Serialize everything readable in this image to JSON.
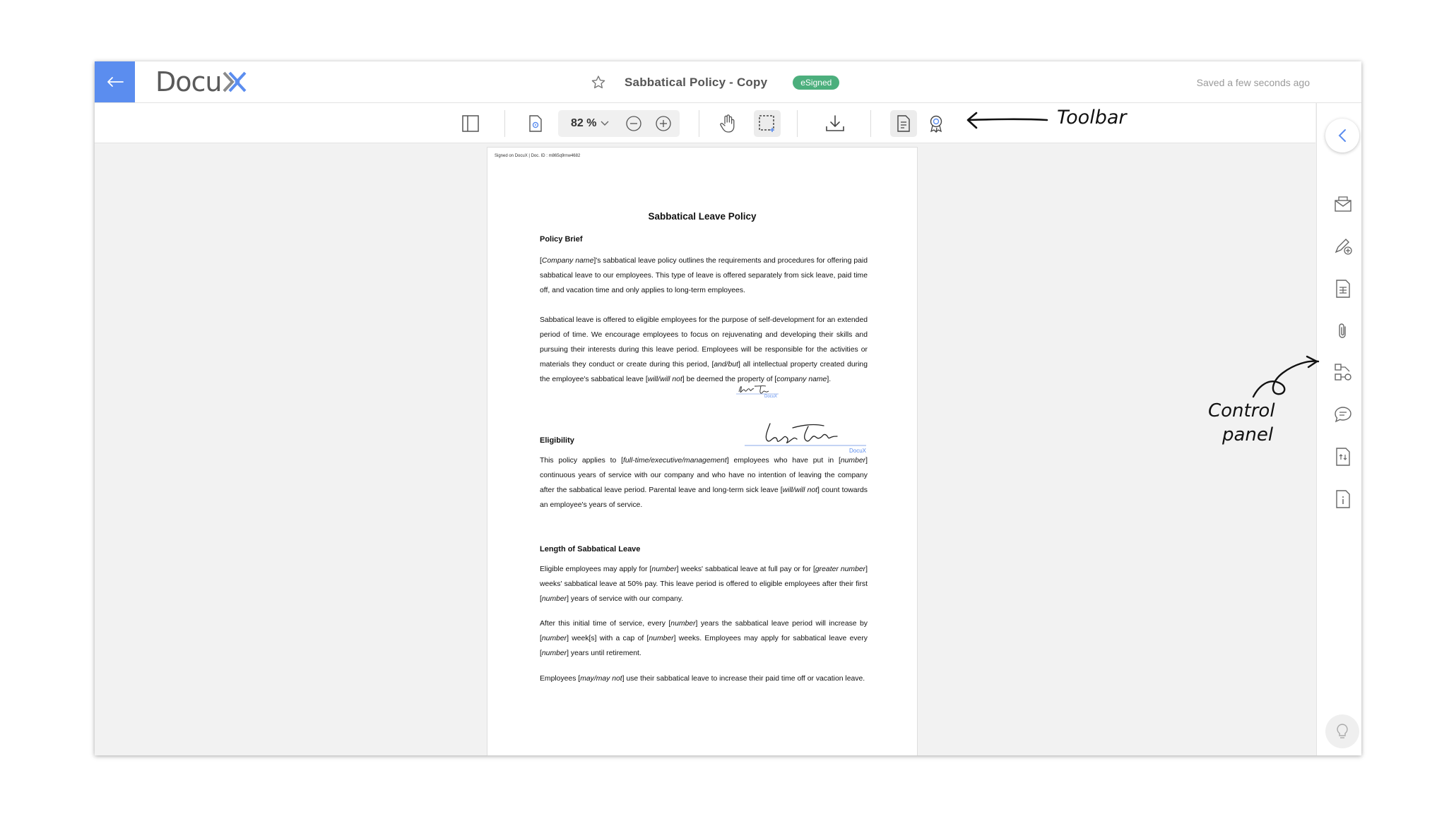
{
  "header": {
    "logo_text": "Docu",
    "logo_mark": "X",
    "doc_title": "Sabbatical Policy - Copy",
    "status_badge": "eSigned",
    "saved_status": "Saved a few seconds ago"
  },
  "toolbar": {
    "zoom": "82 %"
  },
  "document": {
    "signed_line": "Signed on DocuX | Doc. ID : m865q9rnw4682",
    "title": "Sabbatical Leave Policy",
    "sections": {
      "policy_brief": "Policy Brief",
      "eligibility": "Eligibility",
      "length": "Length of Sabbatical Leave"
    },
    "paragraphs": {
      "p1_a": "[",
      "p1_b": "Company name",
      "p1_c": "]'s sabbatical leave policy outlines the requirements and procedures for offering paid sabbatical leave to our employees. This type of leave is offered separately from sick leave, paid time off, and vacation time and only applies to long-term employees.",
      "p2_a": "Sabbatical leave is offered to eligible employees for the purpose of self-development for an extended period of time. We encourage employees to focus on rejuvenating and developing their skills and pursuing their interests during this leave period. Employees will be responsible for the activities or materials they conduct or create during this period, [",
      "p2_b": "and/but",
      "p2_c": "] all intellectual property created during the employee's sabbatical leave [",
      "p2_d": "will/will not",
      "p2_e": "] be deemed the property of [",
      "p2_f": "company name",
      "p2_g": "].",
      "p3_a": "This policy applies to [",
      "p3_b": "full-time/executive/management",
      "p3_c": "] employees who have put in [",
      "p3_d": "number",
      "p3_e": "] continuous years of service with our company and who have no intention of leaving the company after the sabbatical leave period. Parental leave and long-term sick leave [",
      "p3_f": "will/will not",
      "p3_g": "] count towards an employee's years of service.",
      "p4_a": "Eligible employees may apply for [",
      "p4_b": "number",
      "p4_c": "] weeks' sabbatical leave at full pay or for [",
      "p4_d": "greater number",
      "p4_e": "] weeks' sabbatical leave at 50% pay. This leave period is offered to eligible employees after their first [",
      "p4_f": "number",
      "p4_g": "] years of service with our company.",
      "p5_a": "After this initial time of service, every [",
      "p5_b": "number",
      "p5_c": "] years the sabbatical leave period will increase by [",
      "p5_d": "number",
      "p5_e": "] week[s] with a cap of [",
      "p5_f": "number",
      "p5_g": "] weeks. Employees may apply for sabbatical leave every [",
      "p5_h": "number",
      "p5_i": "] years until retirement.",
      "p6_a": "Employees [",
      "p6_b": "may/may not",
      "p6_c": "] use their sabbatical leave to increase their paid time off or vacation leave."
    },
    "signature_stamp": "DocuX"
  },
  "annotations": {
    "toolbar_label": "Toolbar",
    "control_panel_line1": "Control",
    "control_panel_line2": "panel"
  },
  "colors": {
    "accent": "#5b8def",
    "badge": "#4caf7d"
  },
  "icons": [
    "back-arrow-icon",
    "star-icon",
    "sidebar-toggle-icon",
    "page-settings-icon",
    "zoom-out-icon",
    "zoom-in-icon",
    "hand-pan-icon",
    "select-area-icon",
    "download-icon",
    "document-details-icon",
    "certificate-icon",
    "chevron-left-icon",
    "send-envelope-icon",
    "add-signature-icon",
    "form-fields-icon",
    "attachment-icon",
    "workflow-icon",
    "comments-icon",
    "document-versions-icon",
    "info-icon",
    "lightbulb-icon"
  ]
}
